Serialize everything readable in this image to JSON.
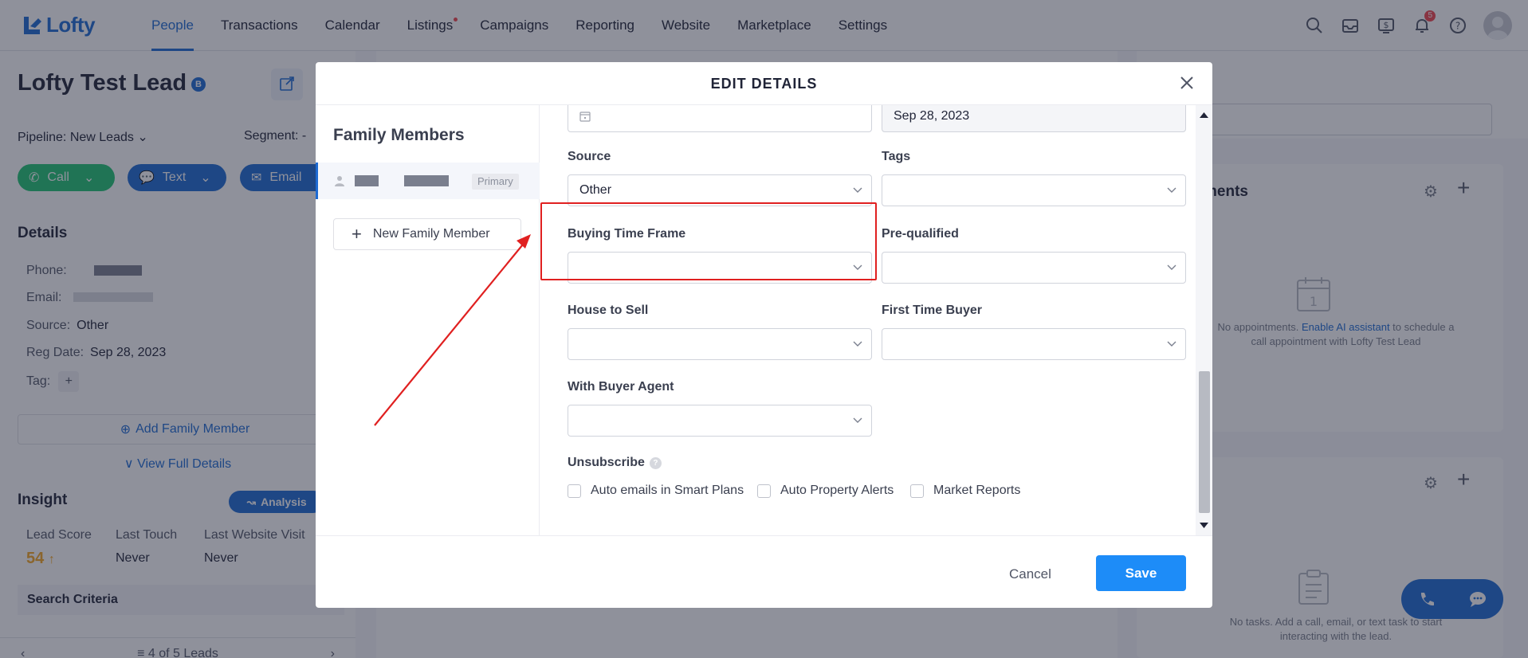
{
  "app": {
    "logo": "Lofty"
  },
  "nav": {
    "items": [
      {
        "label": "People",
        "active": true
      },
      {
        "label": "Transactions"
      },
      {
        "label": "Calendar"
      },
      {
        "label": "Listings",
        "dot": true
      },
      {
        "label": "Campaigns"
      },
      {
        "label": "Reporting"
      },
      {
        "label": "Website"
      },
      {
        "label": "Marketplace"
      },
      {
        "label": "Settings"
      }
    ],
    "notification_count": "5",
    "icons": [
      "search-icon",
      "inbox-icon",
      "dollar-icon",
      "bell-icon",
      "help-icon"
    ]
  },
  "lead": {
    "name": "Lofty Test Lead",
    "badge": "B",
    "pipeline": "Pipeline: New Leads",
    "segment": "Segment: -",
    "actions": {
      "call": "Call",
      "text": "Text",
      "email": "Email"
    },
    "details_title": "Details",
    "phone_label": "Phone:",
    "email_label": "Email:",
    "source_label": "Source:",
    "source_value": "Other",
    "reg_label": "Reg Date:",
    "reg_value": "Sep 28, 2023",
    "tag_label": "Tag:",
    "add_family": "Add Family Member",
    "view_full": "View Full Details",
    "insight_title": "Insight",
    "analysis": "Analysis",
    "lead_score_label": "Lead Score",
    "lead_score": "54",
    "last_touch_label": "Last Touch",
    "last_touch": "Never",
    "last_visit_label": "Last Website Visit",
    "last_visit": "Never",
    "search_criteria": "Search Criteria",
    "leads_pager": "4 of 5 Leads"
  },
  "right": {
    "appointments_title": "ments",
    "appointments_empty_pre": "No appointments. ",
    "appointments_empty_link": "Enable AI assistant",
    "appointments_empty_post": " to schedule a call appointment with Lofty Test Lead",
    "tasks_empty": "No tasks. Add a call, email, or text task to start interacting with the lead."
  },
  "modal": {
    "title": "EDIT DETAILS",
    "family_title": "Family Members",
    "primary_tag": "Primary",
    "new_family": "New Family Member",
    "date_value": "Sep 28, 2023",
    "fields": {
      "source_label": "Source",
      "source_value": "Other",
      "tags_label": "Tags",
      "buying_time_label": "Buying Time Frame",
      "prequalified_label": "Pre-qualified",
      "house_to_sell_label": "House to Sell",
      "first_time_buyer_label": "First Time Buyer",
      "buyer_agent_label": "With Buyer Agent"
    },
    "unsubscribe_label": "Unsubscribe",
    "unsubscribe_options": [
      "Auto emails in Smart Plans",
      "Auto Property Alerts",
      "Market Reports"
    ],
    "cancel": "Cancel",
    "save": "Save"
  }
}
